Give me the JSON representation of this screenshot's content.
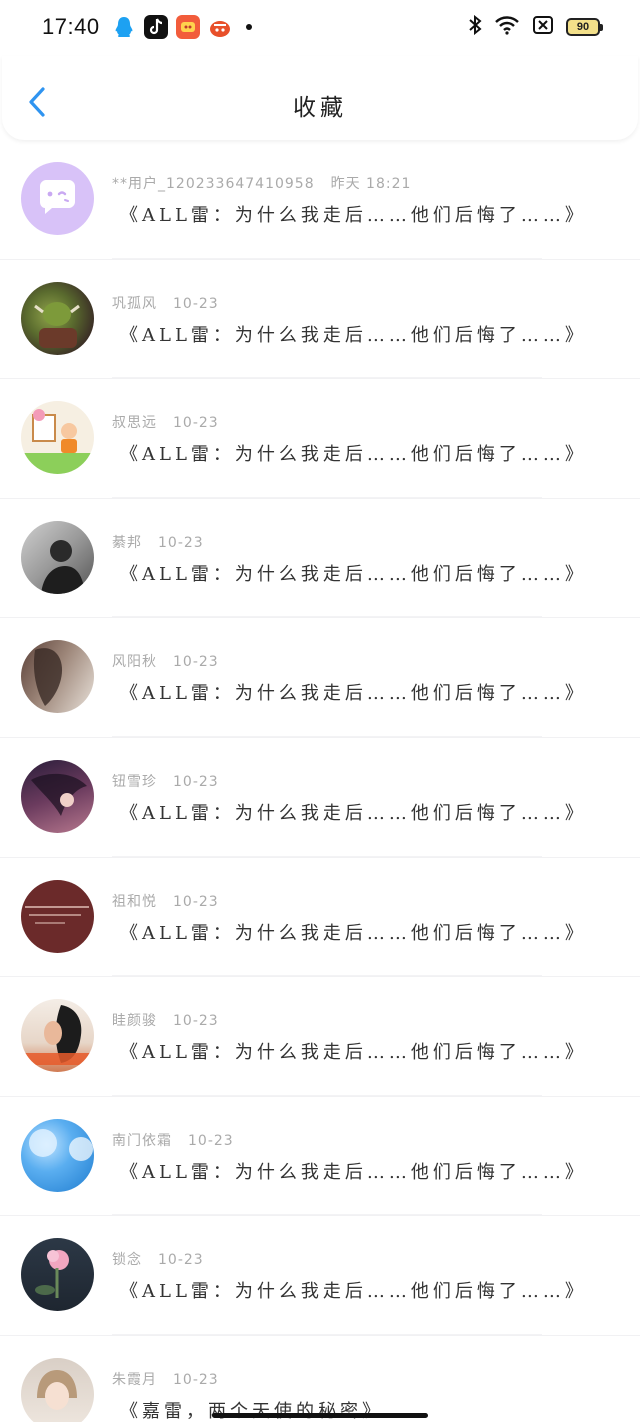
{
  "status_bar": {
    "time": "17:40",
    "battery": "90",
    "apps": [
      "qq-icon",
      "tiktok-icon",
      "game-icon",
      "cart-icon"
    ],
    "right_icons": [
      "bluetooth-icon",
      "wifi-icon",
      "sim-off-icon",
      "battery-icon"
    ]
  },
  "nav": {
    "title": "收藏",
    "back_icon": "chevron-left-icon",
    "accent_color": "#2f94f0"
  },
  "favorites": [
    {
      "user": "**用户_1202336474109​58",
      "time": "昨天 18:21",
      "title": "《ALL雷：为什么我走后……他们后悔了……》",
      "avatar_color": "#d8c2f8"
    },
    {
      "user": "巩孤风",
      "time": "10-23",
      "title": "《ALL雷：为什么我走后……他们后悔了……》",
      "avatar_color": "#5a6b2e"
    },
    {
      "user": "叔思远",
      "time": "10-23",
      "title": "《ALL雷：为什么我走后……他们后悔了……》",
      "avatar_color": "#f3e6d0"
    },
    {
      "user": "綦邦",
      "time": "10-23",
      "title": "《ALL雷：为什么我走后……他们后悔了……》",
      "avatar_color": "#8a8a8a"
    },
    {
      "user": "风阳秋",
      "time": "10-23",
      "title": "《ALL雷：为什么我走后……他们后悔了……》",
      "avatar_color": "#7a6256"
    },
    {
      "user": "钮雪珍",
      "time": "10-23",
      "title": "《ALL雷：为什么我走后……他们后悔了……》",
      "avatar_color": "#4a2d4c"
    },
    {
      "user": "祖和悦",
      "time": "10-23",
      "title": "《ALL雷：为什么我走后……他们后悔了……》",
      "avatar_color": "#6b2a2a"
    },
    {
      "user": "眭颜骏",
      "time": "10-23",
      "title": "《ALL雷：为什么我走后……他们后悔了……》",
      "avatar_color": "#c26a4e"
    },
    {
      "user": "南门依霜",
      "time": "10-23",
      "title": "《ALL雷：为什么我走后……他们后悔了……》",
      "avatar_color": "#2f8fd8"
    },
    {
      "user": "锁念",
      "time": "10-23",
      "title": "《ALL雷：为什么我走后……他们后悔了……》",
      "avatar_color": "#3a4656"
    },
    {
      "user": "朱霞月",
      "time": "10-23",
      "title": "《嘉雷，两个天使的秘密》",
      "avatar_color": "#d9cfc6"
    }
  ]
}
